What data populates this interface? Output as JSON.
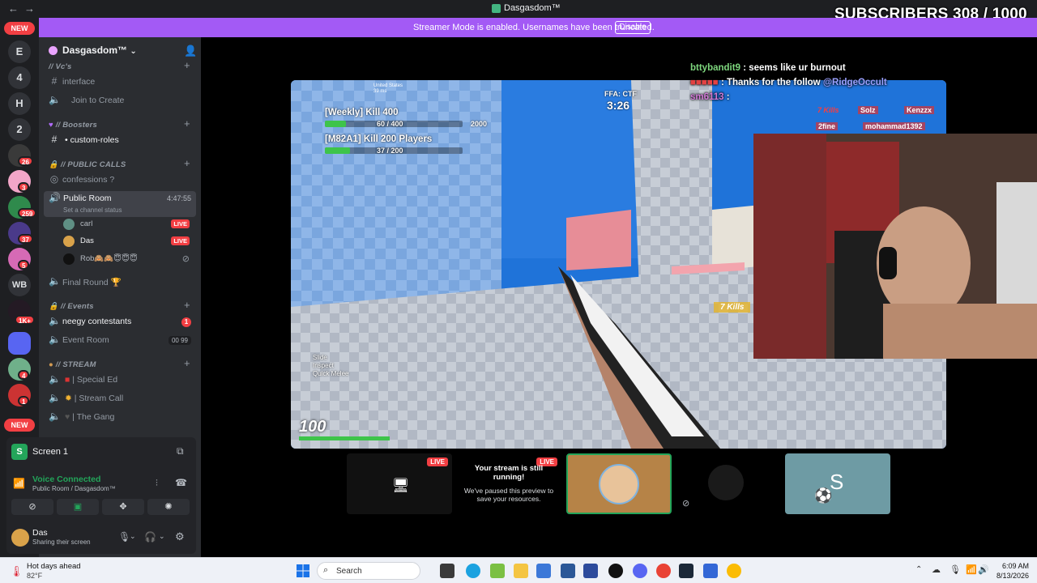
{
  "window": {
    "title": "Dasgasdom™",
    "back": "←",
    "forward": "→"
  },
  "overlay": {
    "subscribers_label": "SUBSCRIBERS",
    "subscribers_count": "308 / 1000"
  },
  "banner": {
    "text": "Streamer Mode is enabled. Usernames have been truncated.",
    "button": "Disable"
  },
  "rail": {
    "new_top": "NEW",
    "new_bottom": "NEW",
    "letters": [
      "E",
      "4",
      "H",
      "2"
    ],
    "badges": [
      "26",
      "3",
      "259",
      "37",
      "5",
      "1K+",
      "4",
      "1"
    ],
    "wb": "WB"
  },
  "server": {
    "name": "Dasgasdom™"
  },
  "categories": {
    "vcs": "// Vc's",
    "boosters": "// Boosters",
    "public_calls": "// PUBLIC CALLS",
    "events": "// Events",
    "stream": "// STREAM"
  },
  "channels": {
    "interface": "interface",
    "join_to_create": "Join to Create",
    "custom_roles": "• custom-roles",
    "confessions": "confessions ?",
    "public_room": "Public Room",
    "public_room_time": "4:47:55",
    "public_room_status": "Set a channel status",
    "final_round": "Final Round 🏆",
    "neegy": "neegy contestants",
    "neegy_count": "1",
    "event_room": "Event Room",
    "event_room_count": "00",
    "event_room_cap": "99",
    "special_ed": "Special Ed",
    "stream_call": "Stream Call",
    "the_gang": "The Gang"
  },
  "voice_users": [
    {
      "name": "carl",
      "live": "LIVE"
    },
    {
      "name": "Das",
      "live": "LIVE"
    },
    {
      "name": "Rob🙈🙈😇😇😇",
      "live": ""
    }
  ],
  "screen_panel": {
    "title": "Screen 1"
  },
  "voice_panel": {
    "status": "Voice Connected",
    "location": "Public Room / Dasgasdom™"
  },
  "user_panel": {
    "name": "Das",
    "status": "Sharing their screen"
  },
  "chat": [
    {
      "user": "bttybandit9",
      "message": ": seems like ur burnout"
    },
    {
      "user": "■■■■■",
      "message": ": Thanks for the follow",
      "mention": "@RidgeOccult"
    },
    {
      "user": "sm6113",
      "message": ":"
    }
  ],
  "game": {
    "region": "United States",
    "ping": "39 ms",
    "mode": "FFA: CTF",
    "timer": "3:26",
    "quest1_title": "[Weekly] Kill 400",
    "quest1_progress": "60 / 400",
    "quest1_fraction": 0.15,
    "quest1_reward": "2000",
    "quest2_title": "[M82A1] Kill 200 Players",
    "quest2_progress": "37 / 200",
    "quest2_fraction": 0.185,
    "killfeed": [
      "7 Kills",
      "Solz",
      "Kenzzx",
      "2fine",
      "mohammad1392"
    ],
    "kills_popup": "7 Kills",
    "controls": [
      "Slide",
      "Inspect",
      "Quick Melee"
    ],
    "health": "100"
  },
  "thumbnails": {
    "live": "LIVE",
    "paused_title": "Your stream is still running!",
    "paused_text": "We've paused this preview to save your resources.",
    "s_letter": "S"
  },
  "taskbar": {
    "weather_title": "Hot days ahead",
    "weather_temp": "82°F",
    "search": "Search",
    "time": "6:09 AM",
    "date": "8/13/2026"
  }
}
